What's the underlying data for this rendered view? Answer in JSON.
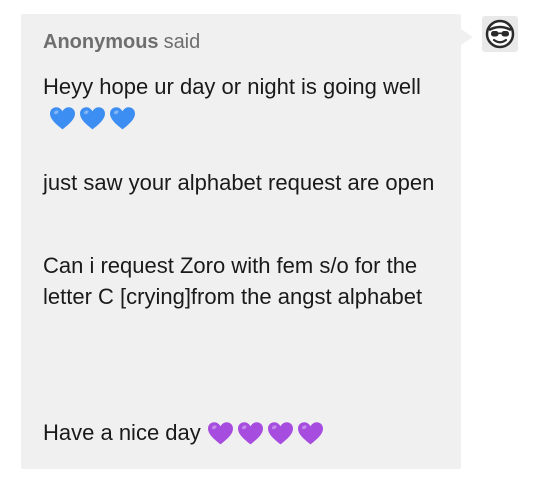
{
  "ask": {
    "asker_name": "Anonymous",
    "asker_verb": "said",
    "line1": "Heyy hope ur day or night is going well",
    "line2": "just saw your  alphabet  request are open",
    "line3": "Can i request  Zoro with fem s/o for the letter C [crying]from the angst alphabet",
    "line4": "Have a nice day"
  },
  "emojis": {
    "blue_hearts": 3,
    "purple_hearts": 4,
    "blue_heart_icon": "blue-heart-icon",
    "purple_heart_icon": "purple-heart-icon"
  },
  "colors": {
    "bubble_bg": "#f0f0f0",
    "text": "#1a1a1a",
    "asker_text": "#6e6e6e",
    "blue_heart": "#3d8ef2",
    "purple_heart": "#a64ddf"
  },
  "avatar": {
    "icon": "sunglasses-face-icon"
  }
}
